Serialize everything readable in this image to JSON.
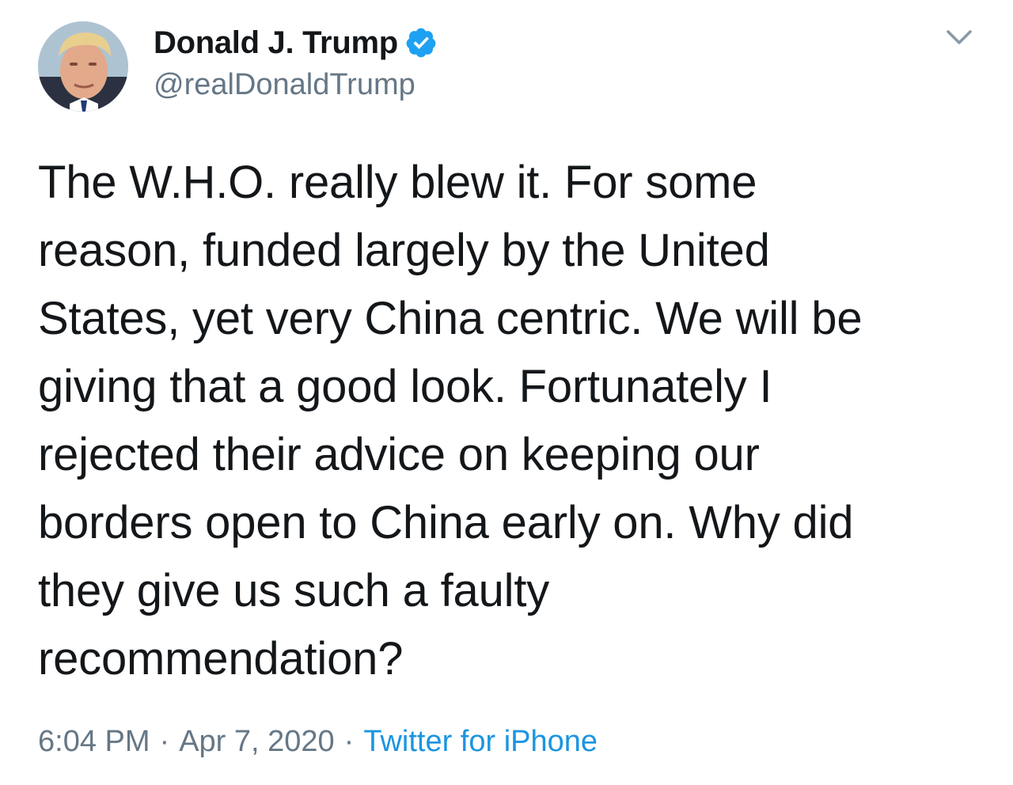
{
  "author": {
    "display_name": "Donald J. Trump",
    "handle": "@realDonaldTrump",
    "verified": true,
    "avatar_icon": "profile-photo"
  },
  "tweet": {
    "text": "The W.H.O. really blew it. For some\nreason, funded largely by the United\nStates, yet very China centric. We will be\ngiving that a good look. Fortunately I\nrejected their advice on keeping our\nborders open to China early on. Why did\nthey give us such a faulty\nrecommendation?",
    "time": "6:04 PM",
    "separator": "·",
    "date": "Apr 7, 2020",
    "source": "Twitter for iPhone"
  },
  "icons": {
    "verified": "verified-badge-icon",
    "menu": "chevron-down-icon"
  },
  "colors": {
    "text": "#14171a",
    "secondary": "#657786",
    "link": "#1b95e0",
    "verified": "#1da1f2"
  }
}
